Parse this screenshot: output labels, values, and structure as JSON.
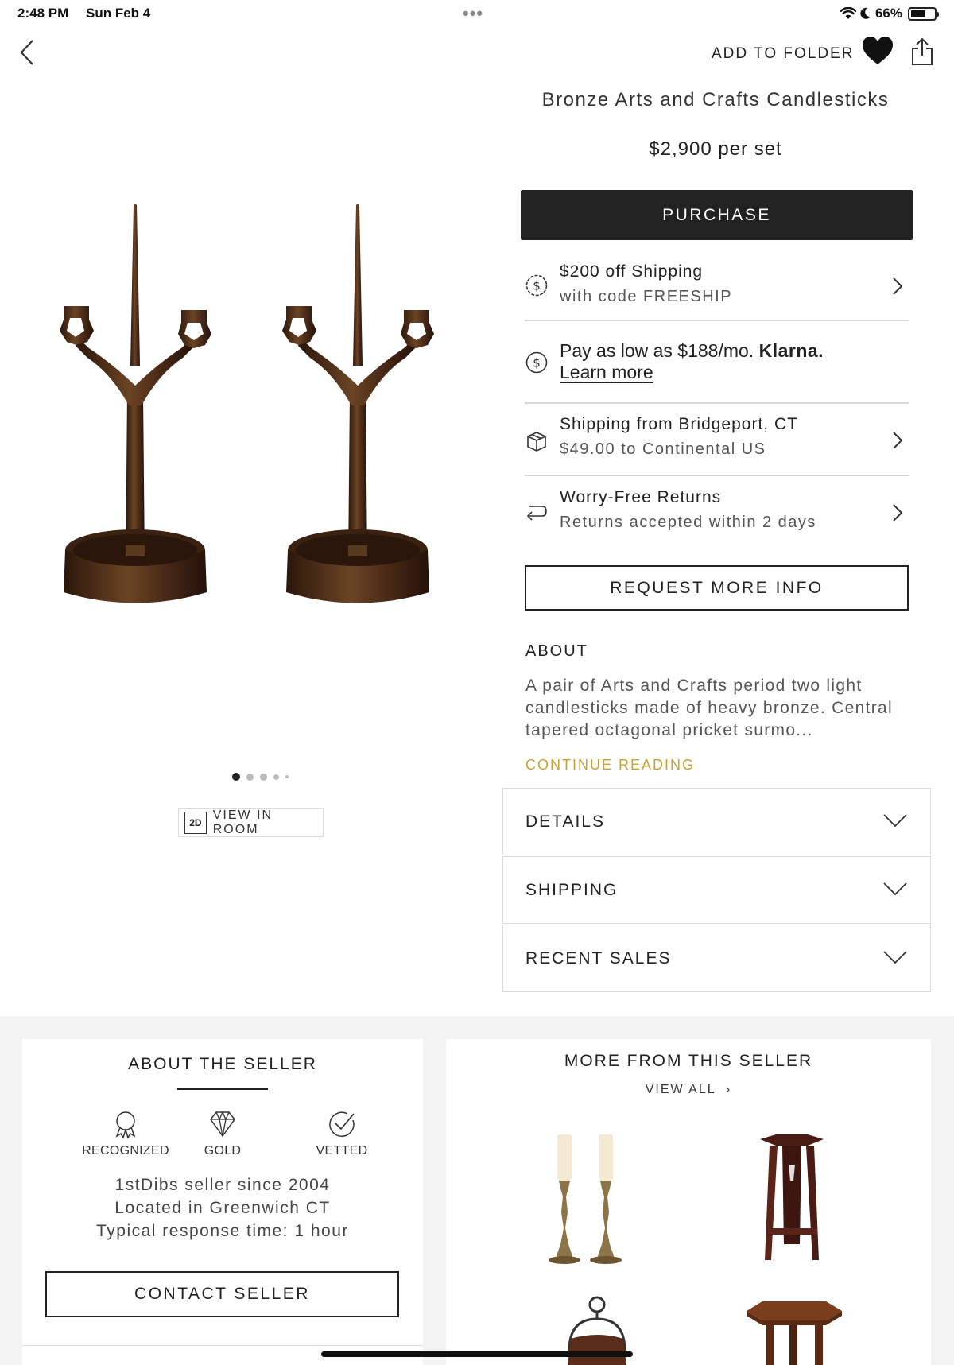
{
  "status_bar": {
    "time": "2:48 PM",
    "date": "Sun Feb 4",
    "battery": "66%",
    "battery_level": 0.66
  },
  "header": {
    "add_to_folder": "ADD TO FOLDER",
    "icons": [
      "back-chevron-icon",
      "heart-icon",
      "share-icon"
    ]
  },
  "product": {
    "title": "Bronze Arts and Crafts Candlesticks",
    "price": "$2,900 per set",
    "purchase_label": "PURCHASE",
    "carousel": {
      "count": 5,
      "active_index": 0
    },
    "view_in_room_icon": "2D",
    "view_in_room": "VIEW IN ROOM"
  },
  "info_rows": {
    "shipping_offer": {
      "title": "$200 off Shipping",
      "subtitle": "with code FREESHIP",
      "icon": "dollar-circle-icon"
    },
    "klarna": {
      "text": "Pay as low as $188/mo.",
      "brand": "Klarna.",
      "link": "Learn more",
      "icon": "dollar-circle-icon"
    },
    "shipping_from": {
      "title": "Shipping from Bridgeport, CT",
      "subtitle": "$49.00 to Continental US",
      "icon": "box-icon"
    },
    "returns": {
      "title": "Worry-Free Returns",
      "subtitle": "Returns accepted within 2 days",
      "icon": "return-arrow-icon"
    }
  },
  "request_info_label": "REQUEST MORE INFO",
  "about": {
    "heading": "ABOUT",
    "text": "A pair of Arts and Crafts period two light candlesticks made of heavy bronze. Central tapered octagonal pricket surmo...",
    "continue": "CONTINUE READING"
  },
  "accordions": [
    {
      "label": "DETAILS"
    },
    {
      "label": "SHIPPING"
    },
    {
      "label": "RECENT SALES"
    }
  ],
  "seller": {
    "heading": "ABOUT THE SELLER",
    "badges": [
      {
        "label": "RECOGNIZED",
        "icon": "ribbon-icon"
      },
      {
        "label": "GOLD",
        "icon": "diamond-icon"
      },
      {
        "label": "VETTED",
        "icon": "check-circle-icon"
      }
    ],
    "since": "1stDibs seller since 2004",
    "location": "Located in Greenwich CT",
    "response": "Typical response time: 1 hour",
    "contact_label": "CONTACT SELLER"
  },
  "more_from_seller": {
    "heading": "MORE FROM THIS SELLER",
    "view_all": "VIEW ALL",
    "items": [
      "brass-candlesticks-thumbnail",
      "mahogany-stand-thumbnail",
      "hanging-pot-thumbnail",
      "octagonal-table-thumbnail"
    ]
  },
  "colors": {
    "accent_gold": "#c9a230",
    "button_dark": "#222222",
    "bronze": "#4a2a17"
  }
}
